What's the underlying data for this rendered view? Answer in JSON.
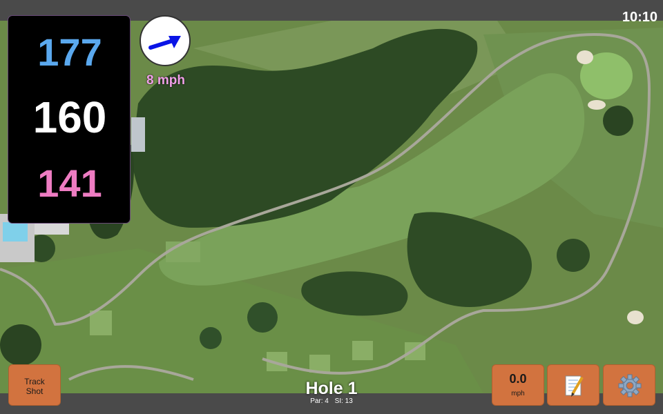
{
  "status": {
    "time": "10:10"
  },
  "distances": {
    "back": "177",
    "middle": "160",
    "front": "141"
  },
  "wind": {
    "speed": "8 mph",
    "arrow_color": "#0a14e6",
    "icon": "wind-direction-arrow"
  },
  "hole": {
    "title": "Hole 1",
    "par": "Par: 4",
    "si": "SI: 13"
  },
  "buttons": {
    "track_shot_line1": "Track",
    "track_shot_line2": "Shot",
    "speed_value": "0.0",
    "speed_unit": "mph",
    "notes_icon": "notepad-pencil-icon",
    "settings_icon": "gear-icon"
  },
  "colors": {
    "back_distance": "#5aa8ee",
    "middle_distance": "#ffffff",
    "front_distance": "#ee7cc2",
    "button": "#d2733f",
    "bar": "#4a4a4a"
  }
}
